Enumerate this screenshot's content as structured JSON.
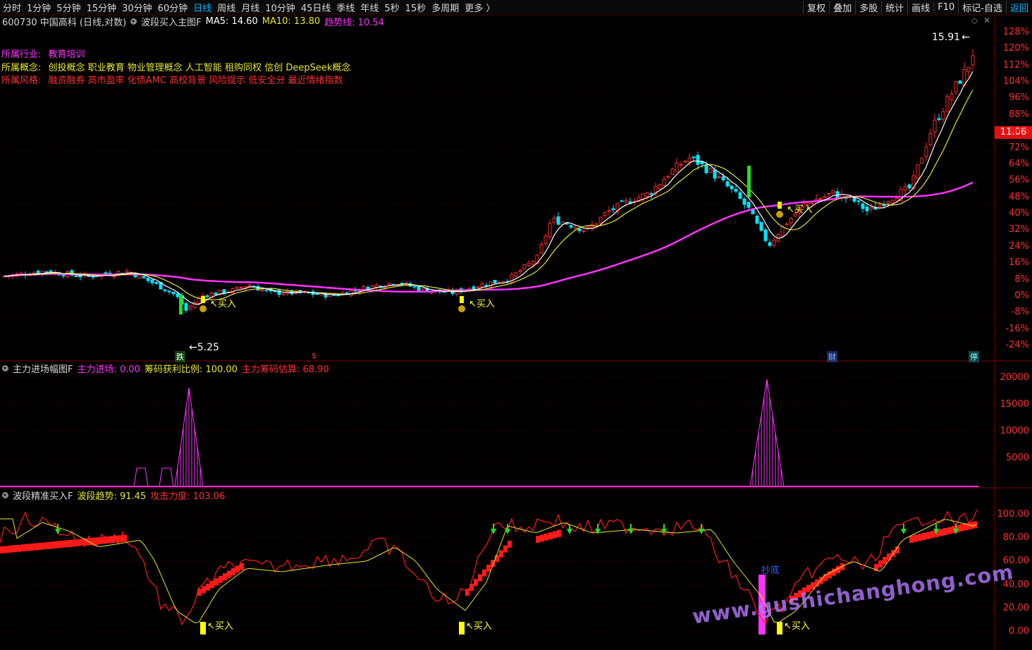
{
  "toolbar": {
    "periods": [
      "分时",
      "1分钟",
      "5分钟",
      "15分钟",
      "30分钟",
      "60分钟",
      "日线",
      "周线",
      "月线",
      "10分钟",
      "45日线",
      "季线",
      "年线",
      "5秒",
      "15秒",
      "多周期",
      "更多 〉"
    ],
    "active_period": "日线",
    "tools": [
      "复权",
      "叠加",
      "多股",
      "统计",
      "画线",
      "F10",
      "标记-自选",
      "返回"
    ]
  },
  "main_panel": {
    "stock": "600730 中国高科 (日线,对数)",
    "indicator": "波段买入主图F",
    "ma5_label": "MA5: 14.60",
    "ma10_label": "MA10: 13.80",
    "trend_label": "趋势线: 10.54",
    "industry_label": "所属行业:",
    "industry_value": "教育培训",
    "concept_label": "所属概念:",
    "concept_value": "创投概念 职业教育 物业管理概念 人工智能 租购同权 信创 DeepSeek概念",
    "style_label": "所属风格:",
    "style_value": "融资融券 高市盈率 化债AMC 高校背景 风险提示 低安全分 最近情绪指数",
    "high_label": "15.91",
    "low_label": "5.25",
    "current_price": "11.06",
    "buy_label": "买入",
    "markers": [
      "跌",
      "$",
      "财",
      "停"
    ],
    "axis": [
      "128%",
      "120%",
      "112%",
      "104%",
      "96%",
      "88%",
      "80%",
      "72%",
      "64%",
      "56%",
      "48%",
      "40%",
      "32%",
      "24%",
      "16%",
      "8%",
      "0%",
      "-8%",
      "-16%",
      "-24%"
    ],
    "colors": {
      "up": "#ff2a2a",
      "down": "#00e5ff",
      "ma5": "#ffffff",
      "ma10": "#e6e62a",
      "trend": "#ff33ff",
      "buy": "#ffff00"
    }
  },
  "panel2": {
    "name": "主力进场幅图F",
    "v1_label": "主力进场: 0.00",
    "v2_label": "筹码获利比例: 100.00",
    "v3_label": "主力筹码估算: 68.90",
    "axis": [
      "20000",
      "15000",
      "10000",
      "5000"
    ]
  },
  "panel3": {
    "name": "波段精准买入F",
    "v1_label": "波段趋势: 91.45",
    "v2_label": "攻击力度: 103.06",
    "bottom_label": "抄底",
    "buy_label": "买入",
    "axis": [
      "100.00",
      "80.00",
      "60.00",
      "40.00",
      "20.00",
      "0.00"
    ]
  },
  "watermark": "www.gushichanghong.com"
}
